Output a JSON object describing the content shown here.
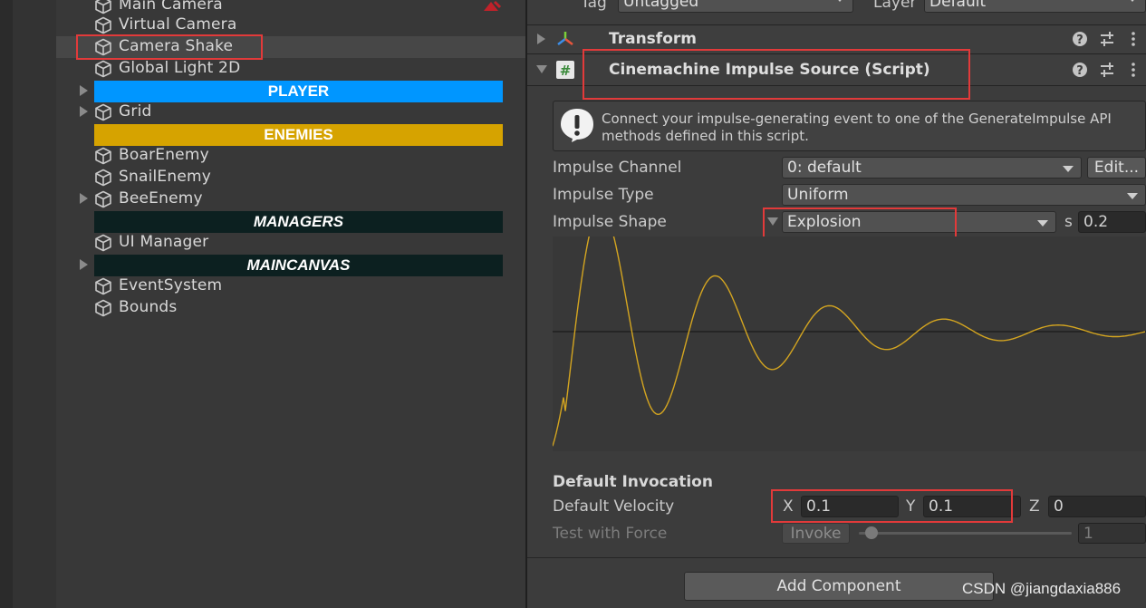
{
  "hierarchy": {
    "items": [
      {
        "label": "Main Camera"
      },
      {
        "label": "Virtual Camera"
      },
      {
        "label": "Camera Shake"
      },
      {
        "label": "Global Light 2D"
      },
      {
        "label": "PLAYER"
      },
      {
        "label": "Grid"
      },
      {
        "label": "ENEMIES"
      },
      {
        "label": "BoarEnemy"
      },
      {
        "label": "SnailEnemy"
      },
      {
        "label": "BeeEnemy"
      },
      {
        "label": "MANAGERS"
      },
      {
        "label": "UI Manager"
      },
      {
        "label": "MAINCANVAS"
      },
      {
        "label": "EventSystem"
      },
      {
        "label": "Bounds"
      }
    ],
    "header_colors": {
      "player": "#0096ff",
      "enemies": "#d6a300",
      "managers": "#0c2020",
      "maincanvas": "#0c2020"
    }
  },
  "inspector": {
    "tag_label": "Tag",
    "tag_value": "Untagged",
    "layer_label": "Layer",
    "layer_value": "Default",
    "transform_title": "Transform",
    "component_title": "Cinemachine Impulse Source (Script)",
    "help_text_line1": "Connect your impulse-generating event to one of the GenerateImpulse API",
    "help_text_line2": "methods defined in this script.",
    "impulse_channel_label": "Impulse Channel",
    "impulse_channel_value": "0: default",
    "edit_button": "Edit...",
    "impulse_type_label": "Impulse Type",
    "impulse_type_value": "Uniform",
    "impulse_shape_label": "Impulse Shape",
    "impulse_shape_value": "Explosion",
    "duration_label": "s",
    "duration_value": "0.2",
    "default_invocation_label": "Default Invocation",
    "default_velocity_label": "Default Velocity",
    "velocity_x_label": "X",
    "velocity_x": "0.1",
    "velocity_y_label": "Y",
    "velocity_y": "0.1",
    "velocity_z_label": "Z",
    "velocity_z": "0",
    "test_force_label": "Test with Force",
    "invoke_button": "Invoke",
    "force_value": "1",
    "add_component": "Add Component"
  },
  "watermark": "CSDN @jiangdaxia886",
  "colors": {
    "highlight": "#e23a3a",
    "curve": "#d4a520"
  }
}
